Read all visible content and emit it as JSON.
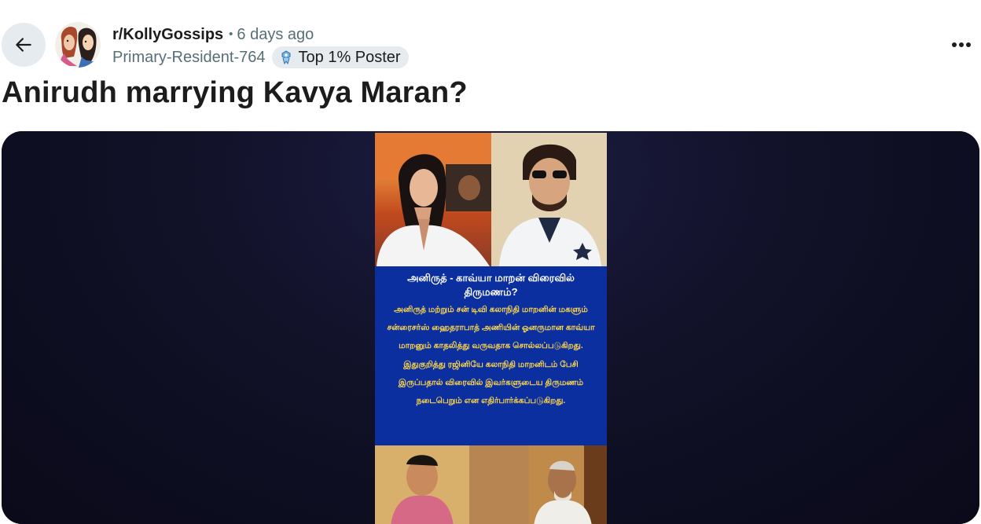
{
  "post": {
    "subreddit": "r/KollyGossips",
    "separator": "•",
    "time": "6 days ago",
    "author": "Primary-Resident-764",
    "flair": "Top 1% Poster",
    "title": "Anirudh marrying Kavya Maran?"
  },
  "image": {
    "heading": "அனிருத் - காவ்யா மாறன் விரைவில் திருமணம்?",
    "body": "அனிருத் மற்றும் சன் டிவி கலாநிதி மாறனின் மகளும் சன்ரைசர்ஸ் ஹைதராபாத் அணியின் ஓனருமான காவ்யா மாறனும் காதலித்து வருவதாக சொல்லப்படுகிறது. இதுகுறித்து ரஜினியே கலாநிதி மாறனிடம் பேசி இருப்பதால் விரைவில் இவர்களுடைய திருமணம் நடைபெறும் என எதிர்பார்க்கப்படுகிறது."
  },
  "icons": {
    "back": "arrow-left-icon",
    "more": "more-horizontal-icon",
    "flair": "top-poster-badge-icon"
  },
  "colors": {
    "back_button_bg": "#e5ebee",
    "flair_bg": "#e5ebee",
    "muted_text": "#576f76",
    "media_bg": "#0d0d22",
    "image_blue": "#0c2fa0",
    "image_heading": "#ffffff",
    "image_body": "#ffd84a"
  }
}
